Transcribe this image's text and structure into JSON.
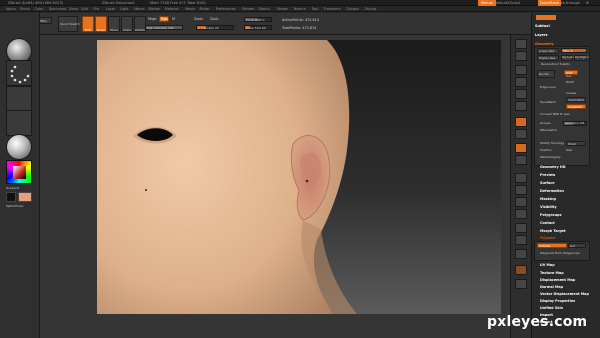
{
  "window": {
    "title_left": "ZBrush 4(x64) 4R4 (4R4:0013)",
    "title_mid": "ZBrush Document",
    "title_info": "Mem 7748  Free 471  Total 8192",
    "quicksave_label": "QuickSave",
    "seethrough_label": "See-through",
    "menus_label": "Menus",
    "default_script_label": "DefaultZScript"
  },
  "menubar": {
    "items": [
      "Alpha",
      "Brush",
      "Color",
      "Document",
      "Draw",
      "Edit",
      "File",
      "Layer",
      "Light",
      "Macro",
      "Marker",
      "Material",
      "Movie",
      "Picker",
      "Preferences",
      "Render",
      "Stencil",
      "Stroke",
      "Texture",
      "Tool",
      "Transform",
      "Zplugin",
      "Zscript"
    ]
  },
  "shelf": {
    "projection_master": "Projection Master",
    "lightbox": "LightBox",
    "quick_sketch": "Quick Sketch",
    "edit_label": "Edit",
    "draw_label": "Draw",
    "move_label": "Move",
    "scale_label": "Scale",
    "rotate_label": "Rotate",
    "mrgb": "Mrgb",
    "rgb": "Rgb",
    "m": "M",
    "rgb_intensity": "Rgb Intensity 100",
    "zadd": "Zadd",
    "zsub": "Zsub",
    "z_intensity": "Z Intensity 25",
    "focal_shift": "Focal Shift 0",
    "draw_size": "Draw Size 64",
    "active_points": "ActivePoints: 472,614",
    "total_points": "TotalPoints: 472,614"
  },
  "left_tray": {
    "gradient_label": "Gradient",
    "switch_color_label": "SwitchColor",
    "alternate_label": "Alternate"
  },
  "right_tray": {
    "header_items": [
      "Subtool",
      "Layers"
    ],
    "geometry_label": "Geometry",
    "lower_res": "Lower Res",
    "higher_res": "Higher Res",
    "sdiv": "SDiv 5",
    "del_lower": "Del Lower",
    "del_higher": "Del Higher",
    "reconstruct_subdiv": "Reconstruct Subdiv",
    "convert_bpr_to_geo": "Convert BPR To Geo",
    "divide_label": "Divide",
    "smt": "Smt",
    "suv": "Suv",
    "reuv": "ReUV",
    "edge_loop": "Edge Loop",
    "crease": "Crease",
    "shadowbox": "ShadowBox",
    "claypolish": "ClayPolish",
    "dynamesh": "DynaMesh",
    "groups": "Groups",
    "polish": "Polish",
    "resolution": "Resolution 128",
    "zremesher": "ZRemesher",
    "freeze_subdivision_levels": "Freeze Subdivision Levels",
    "modify_topology": "Modify Topology",
    "position": "Position",
    "size": "Size",
    "mesh_integrity": "MeshIntegrity",
    "layers_sections": [
      "Geometry HD",
      "Preview",
      "Surface",
      "Deformation",
      "Masking",
      "Visibility",
      "Polygroups",
      "Contact",
      "Morph Target",
      "Polypaint"
    ],
    "colorize_label": "Colorize",
    "grd_label": "Grd",
    "polypaint_from_polygroups": "Polypaint From Polygroups",
    "lower_sections": [
      "UV Map",
      "Texture Map",
      "Displacement Map",
      "Normal Map",
      "Vector Displacement Map",
      "Display Properties",
      "Unified Skin",
      "Import",
      "Export"
    ]
  },
  "watermark": "pxleyes.com",
  "colors": {
    "accent": "#e8731e",
    "panel_bg": "#2b2b2b",
    "skin": "#e2b895"
  }
}
